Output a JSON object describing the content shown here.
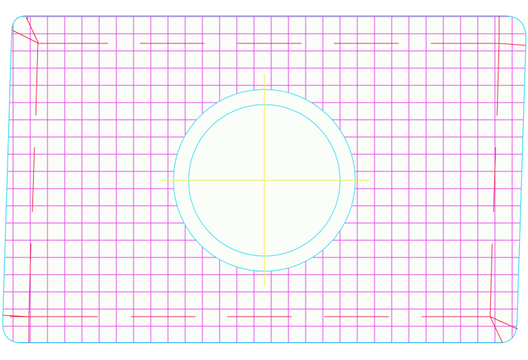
{
  "drawing": {
    "view": "sheet-outline-with-circular-cutout",
    "colors": {
      "background": "#ffffff",
      "panel_fill": "#fbfdf9",
      "outline": "#33ddee",
      "grid": "#e040e8",
      "grid_edge": "#8866ff",
      "marks": "#ee2244",
      "centerline": "#f0f060"
    },
    "grid": {
      "visible": true
    },
    "cutout": {
      "shape": "concentric-circles",
      "count": 2,
      "has_centerlines": true
    }
  }
}
